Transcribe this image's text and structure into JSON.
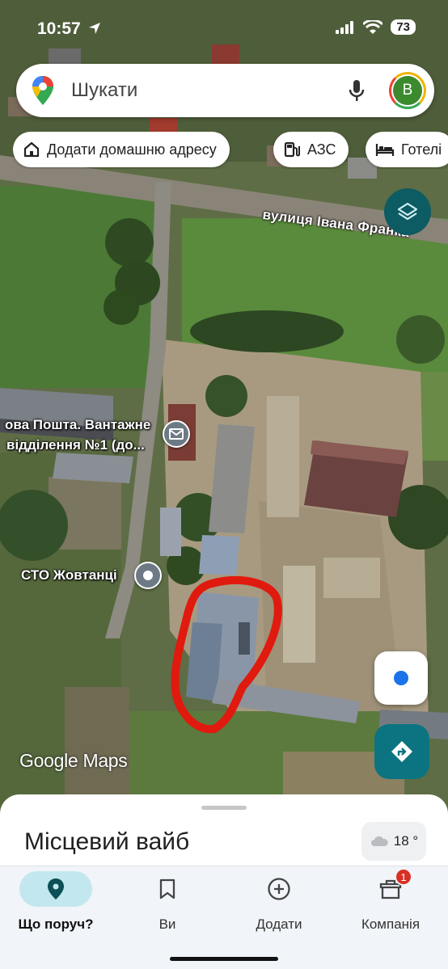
{
  "status_bar": {
    "time": "10:57",
    "battery": "73"
  },
  "search": {
    "placeholder": "Шукати",
    "avatar_letter": "B"
  },
  "chips": [
    {
      "label": "Додати домашню адресу",
      "icon": "home-icon"
    },
    {
      "label": "АЗС",
      "icon": "fuel-icon"
    },
    {
      "label": "Готелі",
      "icon": "bed-icon"
    }
  ],
  "map": {
    "street_label": "вулиця Івана Франка",
    "poi_post_line1": "ова Пошта. Вантажне",
    "poi_post_line2": "відділення №1 (до...",
    "poi_sto": "СТО Жовтанці",
    "logo": "Google Maps",
    "annotation_color": "#e01a0e"
  },
  "sheet": {
    "title": "Місцевий вайб",
    "temperature": "18 °"
  },
  "nav": [
    {
      "label": "Що поруч?",
      "icon": "location-pin-icon",
      "active": true
    },
    {
      "label": "Ви",
      "icon": "bookmark-icon"
    },
    {
      "label": "Додати",
      "icon": "add-circle-icon"
    },
    {
      "label": "Компанія",
      "icon": "store-icon",
      "badge": "1"
    }
  ],
  "colors": {
    "accent": "#0b7480",
    "active_nav": "#c2e7ee",
    "badge": "#d93025"
  }
}
